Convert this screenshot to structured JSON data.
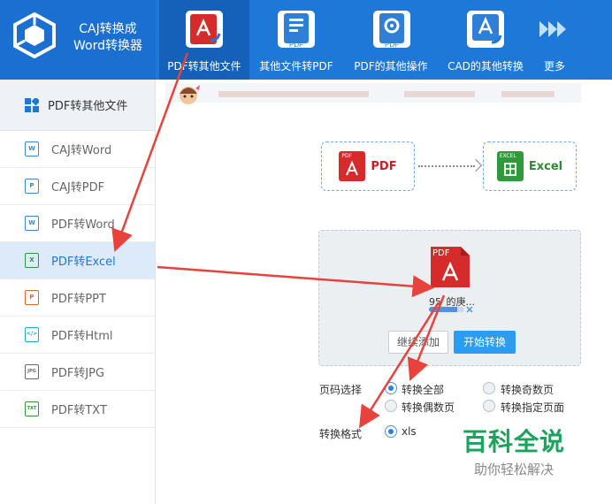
{
  "brand": {
    "title_line1": "CAJ转换成",
    "title_line2": "Word转换器"
  },
  "nav": [
    {
      "label": "PDF转其他文件",
      "icon": "pdf-export-icon"
    },
    {
      "label": "其他文件转PDF",
      "icon": "file-to-pdf-icon"
    },
    {
      "label": "PDF的其他操作",
      "icon": "pdf-settings-icon"
    },
    {
      "label": "CAD的其他转换",
      "icon": "cad-convert-icon"
    },
    {
      "label": "更多",
      "icon": "more-arrows-icon"
    }
  ],
  "sidebar": {
    "header": "PDF转其他文件",
    "items": [
      {
        "label": "CAJ转Word",
        "icon_text": "W"
      },
      {
        "label": "CAJ转PDF",
        "icon_text": "P"
      },
      {
        "label": "PDF转Word",
        "icon_text": "W"
      },
      {
        "label": "PDF转Excel",
        "icon_text": "X"
      },
      {
        "label": "PDF转PPT",
        "icon_text": "P"
      },
      {
        "label": "PDF转Html",
        "icon_text": "</>"
      },
      {
        "label": "PDF转JPG",
        "icon_text": "JPG"
      },
      {
        "label": "PDF转TXT",
        "icon_text": "TXT"
      }
    ]
  },
  "conversion": {
    "from_label": "PDF",
    "from_tag": "PDF",
    "to_label": "Excel",
    "to_tag": "EXCEL"
  },
  "file": {
    "tag": "PDF",
    "name": "95_的庚...",
    "progress": 0.8
  },
  "buttons": {
    "add": "继续添加",
    "start": "开始转换"
  },
  "options": {
    "page_label": "页码选择",
    "all": "转换全部",
    "odd": "转换奇数页",
    "even": "转换偶数页",
    "specified": "转换指定页面",
    "format_label": "转换格式",
    "format_value": "xls"
  },
  "watermark": {
    "main": "百科全说",
    "sub": "助你轻松解决"
  },
  "colors": {
    "header": "#1e78d7",
    "accent": "#2b9cf0",
    "pdf_red": "#d62b2b",
    "excel_green": "#2f9a3a",
    "annotation": "#e8423c"
  }
}
